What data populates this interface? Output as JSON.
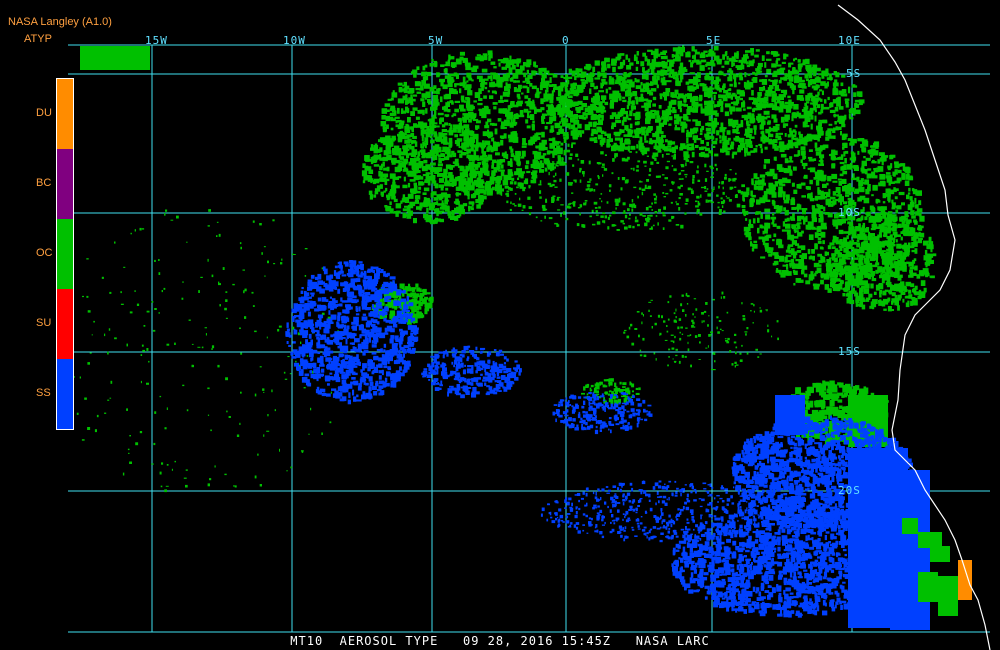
{
  "header": {
    "title": "NASA Langley (A1.0)",
    "product": "ATYP"
  },
  "legend": [
    {
      "code": "DU",
      "color": "#ff8c00"
    },
    {
      "code": "BC",
      "color": "#800080"
    },
    {
      "code": "OC",
      "color": "#00c000"
    },
    {
      "code": "SU",
      "color": "#ff0000"
    },
    {
      "code": "SS",
      "color": "#0040ff"
    }
  ],
  "lon_labels": [
    "15W",
    "10W",
    "5W",
    "0",
    "5E",
    "10E"
  ],
  "lat_labels": [
    "5S",
    "10S",
    "15S",
    "20S"
  ],
  "footer": "MT10  AEROSOL TYPE   09 28, 2016 15:45Z   NASA LARC",
  "colors": {
    "grid": "#40e0f0",
    "coast": "#ffffff",
    "background": "#000000"
  }
}
